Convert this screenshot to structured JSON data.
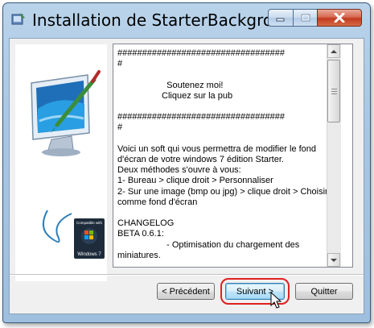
{
  "window": {
    "title": "Installation de StarterBackgroundC...",
    "controls": {
      "minimize_icon": "minimize-icon",
      "maximize_icon": "maximize-icon",
      "close_icon": "close-icon"
    }
  },
  "sidebar": {
    "badge_top": "Compatible with",
    "badge_bottom": "Windows 7"
  },
  "content": {
    "text": "##################################\n#\n\n                    Soutenez moi!\n                  Cliquez sur la pub\n\n##################################\n#\n\nVoici un soft qui vous permettra de modifier le fond\nd'écran de votre windows 7 édition Starter.\nDeux méthodes s'ouvre à vous:\n1- Bureau > clique droit > Personnaliser\n2- Sur une image (bmp ou jpg) > clique droit > Choisir\ncomme fond d'écran\n\nCHANGELOG\nBETA 0.6.1:\n                    - Optimisation du chargement des\nminiatures.",
    "scroll_position": 0.0
  },
  "buttons": {
    "back": "< Précédent",
    "next": "Suivant >",
    "quit": "Quitter"
  },
  "colors": {
    "highlight": "#e02020",
    "titlebar": "#b9d3ea"
  }
}
